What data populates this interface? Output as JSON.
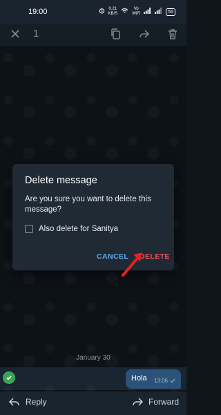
{
  "status_bar": {
    "time": "19:00",
    "speed_value": "0.21",
    "speed_unit": "KB/S",
    "network": "Vo\nWiFi",
    "battery": "55"
  },
  "toolbar": {
    "selected_count": "1",
    "icons": [
      "close-icon",
      "copy-icon",
      "forward-icon",
      "delete-icon"
    ]
  },
  "dialog": {
    "title": "Delete message",
    "message": "Are you sure you want to delete this message?",
    "checkbox_label": "Also delete for Sanitya",
    "checkbox_checked": false,
    "cancel_label": "CANCEL",
    "delete_label": "DELETE"
  },
  "chat": {
    "date_separator": "January 30",
    "message_text": "Hola",
    "message_time": "13:06"
  },
  "bottom_bar": {
    "reply_label": "Reply",
    "forward_label": "Forward"
  },
  "colors": {
    "accent": "#5fa9e6",
    "danger": "#e8525a",
    "annotation_arrow": "#e32026",
    "selected_check": "#3aa655"
  }
}
